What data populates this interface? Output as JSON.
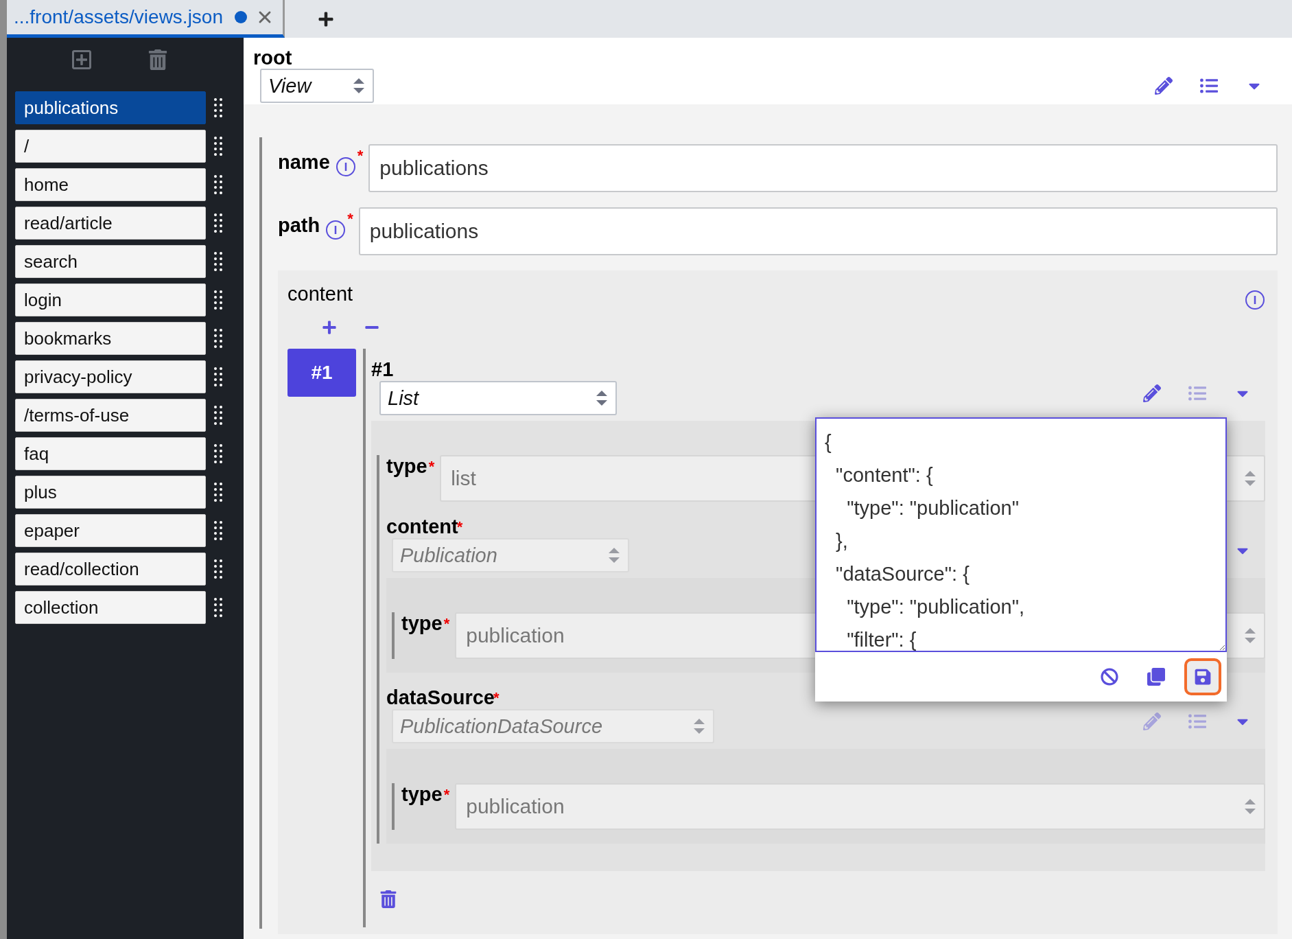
{
  "tabs": [
    {
      "label": "...front/assets/views.json",
      "modified": true,
      "selected": true
    }
  ],
  "sidebar": {
    "items": [
      {
        "label": "publications",
        "selected": true
      },
      {
        "label": "/",
        "selected": false
      },
      {
        "label": "home",
        "selected": false
      },
      {
        "label": "read/article",
        "selected": false
      },
      {
        "label": "search",
        "selected": false
      },
      {
        "label": "login",
        "selected": false
      },
      {
        "label": "bookmarks",
        "selected": false
      },
      {
        "label": "privacy-policy",
        "selected": false
      },
      {
        "label": "/terms-of-use",
        "selected": false
      },
      {
        "label": "faq",
        "selected": false
      },
      {
        "label": "plus",
        "selected": false
      },
      {
        "label": "epaper",
        "selected": false
      },
      {
        "label": "read/collection",
        "selected": false
      },
      {
        "label": "collection",
        "selected": false
      }
    ]
  },
  "root": {
    "label": "root",
    "type_select": "View",
    "tools": [
      {
        "kind": "edit",
        "disabled": false
      },
      {
        "kind": "list",
        "disabled": false
      },
      {
        "kind": "expand",
        "disabled": false
      }
    ]
  },
  "fields": [
    {
      "label": "name",
      "required_mark": "*",
      "value": "publications"
    },
    {
      "label": "path",
      "required_mark": "*",
      "value": "publications"
    }
  ],
  "content": {
    "label": "content",
    "items": [
      {
        "index": "#1",
        "selected": true,
        "title": "#1",
        "type_select": "List",
        "tools": [
          {
            "kind": "edit",
            "disabled": false
          },
          {
            "kind": "list",
            "disabled": true
          },
          {
            "kind": "expand",
            "disabled": false
          }
        ],
        "properties": [
          {
            "kind": "field",
            "label": "type",
            "required_mark": "*",
            "value": "list"
          },
          {
            "kind": "object",
            "label": "content",
            "required_mark": "*",
            "select": "Publication",
            "tools": [
              {
                "kind": "expand",
                "disabled": false
              }
            ],
            "children": [
              {
                "kind": "field",
                "label": "type",
                "required_mark": "*",
                "value": "publication"
              }
            ]
          },
          {
            "kind": "object",
            "label": "dataSource",
            "required_mark": "*",
            "select": "PublicationDataSource",
            "tools": [
              {
                "kind": "edit",
                "disabled": true
              },
              {
                "kind": "list",
                "disabled": true
              },
              {
                "kind": "expand",
                "disabled": false
              }
            ],
            "children": [
              {
                "kind": "field",
                "label": "type",
                "required_mark": "*",
                "value": "publication"
              }
            ]
          }
        ]
      }
    ]
  },
  "popup": {
    "lines": [
      "{",
      "  \"content\": {",
      "    \"type\": \"publication\"",
      "  },",
      "  \"dataSource\": {",
      "    \"type\": \"publication\",",
      "    \"filter\": {"
    ],
    "actions": [
      {
        "kind": "cancel",
        "selected": false
      },
      {
        "kind": "copy",
        "selected": false
      },
      {
        "kind": "save",
        "selected": true
      }
    ]
  }
}
